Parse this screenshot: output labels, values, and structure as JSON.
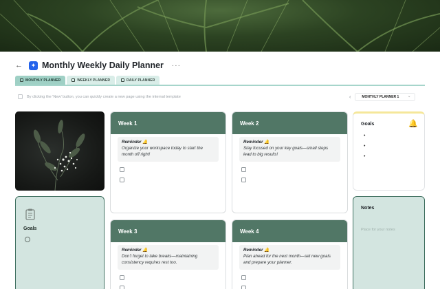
{
  "page": {
    "title": "Monthly Weekly Daily Planner",
    "back_icon": "arrow-left-icon",
    "app_icon": "planner-app-icon",
    "more_label": "···"
  },
  "tabs": [
    {
      "label": "MONTHLY PLANNER",
      "active": true
    },
    {
      "label": "WEEKLY PLANNER",
      "active": false
    },
    {
      "label": "DAILY PLANNER",
      "active": false
    }
  ],
  "hint": {
    "text": "By clicking the 'New' button, you can quickly create a new page using the internal template"
  },
  "month_selector": {
    "prev": "‹",
    "value": "MONTHLY PLANNER 1",
    "chevron": "⌄"
  },
  "left_goals": {
    "title": "Goals",
    "icon": "clipboard-icon"
  },
  "weeks": [
    {
      "title": "Week 1",
      "reminder_title": "Reminder 🔔",
      "reminder_text": "Organize your workspace today to start the month off right!"
    },
    {
      "title": "Week 2",
      "reminder_title": "Reminder 🔔",
      "reminder_text": "Stay focused on your key goals—small steps lead to big results!"
    },
    {
      "title": "Week 3",
      "reminder_title": "Reminder 🔔",
      "reminder_text": "Don't forget to take breaks—maintaining consistency requires rest too."
    },
    {
      "title": "Week 4",
      "reminder_title": "Reminder 🔔",
      "reminder_text": "Plan ahead for the next month—set new goals and prepare your planner."
    }
  ],
  "right_goals": {
    "title": "Goals",
    "bell_icon": "bell-icon"
  },
  "notes": {
    "title": "Notes",
    "placeholder": "Place for your notes"
  },
  "colors": {
    "accent_teal": "#517766",
    "tab_active": "#9fd0c5",
    "card_mint": "#d3e5e0",
    "app_blue": "#2463eb"
  }
}
